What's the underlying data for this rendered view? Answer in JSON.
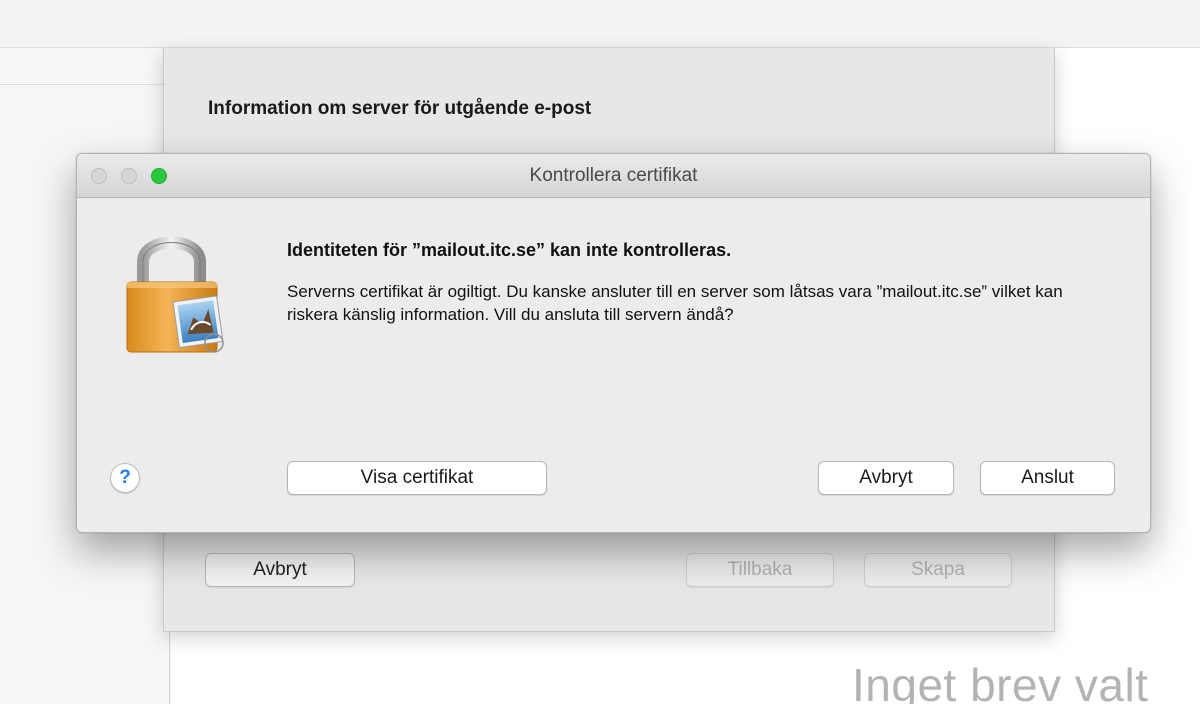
{
  "background": {
    "no_message_text": "Inget brev valt"
  },
  "setup_sheet": {
    "title": "Information om server för utgående e-post",
    "cancel_label": "Avbryt",
    "back_label": "Tillbaka",
    "create_label": "Skapa"
  },
  "dialog": {
    "window_title": "Kontrollera certifikat",
    "headline": "Identiteten för ”mailout.itc.se” kan inte kontrolleras.",
    "message": "Serverns certifikat är ogiltigt. Du kanske ansluter till en server som låtsas vara ”mailout.itc.se” vilket kan riskera känslig information. Vill du ansluta till servern ändå?",
    "help_label": "?",
    "show_certificate_label": "Visa certifikat",
    "cancel_label": "Avbryt",
    "connect_label": "Anslut",
    "icon": "lock-with-mail-stamp-icon",
    "traffic_lights": {
      "close": "#d6d6d6",
      "minimize": "#d6d6d6",
      "zoom": "#27c93f"
    }
  }
}
